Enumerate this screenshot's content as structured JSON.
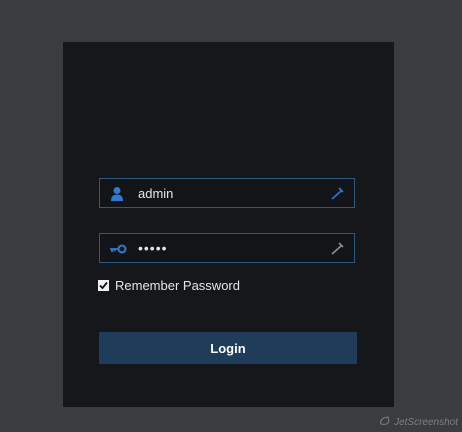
{
  "login_form": {
    "username_value": "admin",
    "password_mask": "•••••",
    "remember_label": "Remember Password",
    "remember_checked": true,
    "login_label": "Login"
  },
  "icons": {
    "username": "user-icon",
    "password": "key-icon",
    "field_tool": "wrench-icon",
    "checkbox": "checkmark-icon"
  },
  "colors": {
    "page_bg": "#3a3c3f",
    "panel_bg": "#16171b",
    "accent_blue": "#2e7ad1",
    "field_border": "#2a5a80",
    "button_bg": "#1f3d5b"
  },
  "watermark": {
    "text": "JetScreenshot"
  }
}
